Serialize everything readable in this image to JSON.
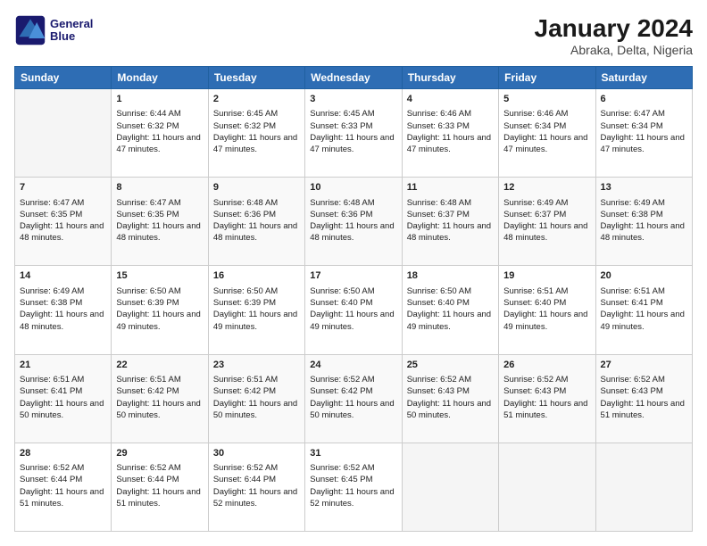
{
  "header": {
    "logo_line1": "General",
    "logo_line2": "Blue",
    "title": "January 2024",
    "subtitle": "Abraka, Delta, Nigeria"
  },
  "weekdays": [
    "Sunday",
    "Monday",
    "Tuesday",
    "Wednesday",
    "Thursday",
    "Friday",
    "Saturday"
  ],
  "weeks": [
    [
      {
        "num": "",
        "info": ""
      },
      {
        "num": "1",
        "info": "Sunrise: 6:44 AM\nSunset: 6:32 PM\nDaylight: 11 hours and 47 minutes."
      },
      {
        "num": "2",
        "info": "Sunrise: 6:45 AM\nSunset: 6:32 PM\nDaylight: 11 hours and 47 minutes."
      },
      {
        "num": "3",
        "info": "Sunrise: 6:45 AM\nSunset: 6:33 PM\nDaylight: 11 hours and 47 minutes."
      },
      {
        "num": "4",
        "info": "Sunrise: 6:46 AM\nSunset: 6:33 PM\nDaylight: 11 hours and 47 minutes."
      },
      {
        "num": "5",
        "info": "Sunrise: 6:46 AM\nSunset: 6:34 PM\nDaylight: 11 hours and 47 minutes."
      },
      {
        "num": "6",
        "info": "Sunrise: 6:47 AM\nSunset: 6:34 PM\nDaylight: 11 hours and 47 minutes."
      }
    ],
    [
      {
        "num": "7",
        "info": "Sunrise: 6:47 AM\nSunset: 6:35 PM\nDaylight: 11 hours and 48 minutes."
      },
      {
        "num": "8",
        "info": "Sunrise: 6:47 AM\nSunset: 6:35 PM\nDaylight: 11 hours and 48 minutes."
      },
      {
        "num": "9",
        "info": "Sunrise: 6:48 AM\nSunset: 6:36 PM\nDaylight: 11 hours and 48 minutes."
      },
      {
        "num": "10",
        "info": "Sunrise: 6:48 AM\nSunset: 6:36 PM\nDaylight: 11 hours and 48 minutes."
      },
      {
        "num": "11",
        "info": "Sunrise: 6:48 AM\nSunset: 6:37 PM\nDaylight: 11 hours and 48 minutes."
      },
      {
        "num": "12",
        "info": "Sunrise: 6:49 AM\nSunset: 6:37 PM\nDaylight: 11 hours and 48 minutes."
      },
      {
        "num": "13",
        "info": "Sunrise: 6:49 AM\nSunset: 6:38 PM\nDaylight: 11 hours and 48 minutes."
      }
    ],
    [
      {
        "num": "14",
        "info": "Sunrise: 6:49 AM\nSunset: 6:38 PM\nDaylight: 11 hours and 48 minutes."
      },
      {
        "num": "15",
        "info": "Sunrise: 6:50 AM\nSunset: 6:39 PM\nDaylight: 11 hours and 49 minutes."
      },
      {
        "num": "16",
        "info": "Sunrise: 6:50 AM\nSunset: 6:39 PM\nDaylight: 11 hours and 49 minutes."
      },
      {
        "num": "17",
        "info": "Sunrise: 6:50 AM\nSunset: 6:40 PM\nDaylight: 11 hours and 49 minutes."
      },
      {
        "num": "18",
        "info": "Sunrise: 6:50 AM\nSunset: 6:40 PM\nDaylight: 11 hours and 49 minutes."
      },
      {
        "num": "19",
        "info": "Sunrise: 6:51 AM\nSunset: 6:40 PM\nDaylight: 11 hours and 49 minutes."
      },
      {
        "num": "20",
        "info": "Sunrise: 6:51 AM\nSunset: 6:41 PM\nDaylight: 11 hours and 49 minutes."
      }
    ],
    [
      {
        "num": "21",
        "info": "Sunrise: 6:51 AM\nSunset: 6:41 PM\nDaylight: 11 hours and 50 minutes."
      },
      {
        "num": "22",
        "info": "Sunrise: 6:51 AM\nSunset: 6:42 PM\nDaylight: 11 hours and 50 minutes."
      },
      {
        "num": "23",
        "info": "Sunrise: 6:51 AM\nSunset: 6:42 PM\nDaylight: 11 hours and 50 minutes."
      },
      {
        "num": "24",
        "info": "Sunrise: 6:52 AM\nSunset: 6:42 PM\nDaylight: 11 hours and 50 minutes."
      },
      {
        "num": "25",
        "info": "Sunrise: 6:52 AM\nSunset: 6:43 PM\nDaylight: 11 hours and 50 minutes."
      },
      {
        "num": "26",
        "info": "Sunrise: 6:52 AM\nSunset: 6:43 PM\nDaylight: 11 hours and 51 minutes."
      },
      {
        "num": "27",
        "info": "Sunrise: 6:52 AM\nSunset: 6:43 PM\nDaylight: 11 hours and 51 minutes."
      }
    ],
    [
      {
        "num": "28",
        "info": "Sunrise: 6:52 AM\nSunset: 6:44 PM\nDaylight: 11 hours and 51 minutes."
      },
      {
        "num": "29",
        "info": "Sunrise: 6:52 AM\nSunset: 6:44 PM\nDaylight: 11 hours and 51 minutes."
      },
      {
        "num": "30",
        "info": "Sunrise: 6:52 AM\nSunset: 6:44 PM\nDaylight: 11 hours and 52 minutes."
      },
      {
        "num": "31",
        "info": "Sunrise: 6:52 AM\nSunset: 6:45 PM\nDaylight: 11 hours and 52 minutes."
      },
      {
        "num": "",
        "info": ""
      },
      {
        "num": "",
        "info": ""
      },
      {
        "num": "",
        "info": ""
      }
    ]
  ]
}
